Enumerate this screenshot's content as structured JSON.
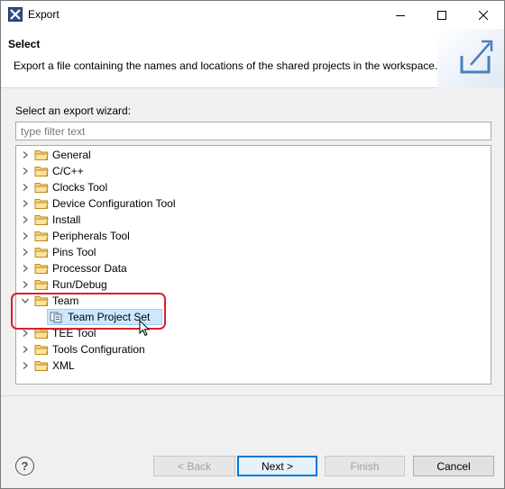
{
  "window": {
    "title": "Export"
  },
  "header": {
    "title": "Select",
    "description": "Export a file containing the names and locations of the shared projects in the workspace."
  },
  "wizard": {
    "section_label": "Select an export wizard:",
    "filter_placeholder": "type filter text",
    "filter_value": ""
  },
  "tree": {
    "items": [
      {
        "label": "General",
        "expanded": false
      },
      {
        "label": "C/C++",
        "expanded": false
      },
      {
        "label": "Clocks Tool",
        "expanded": false
      },
      {
        "label": "Device Configuration Tool",
        "expanded": false
      },
      {
        "label": "Install",
        "expanded": false
      },
      {
        "label": "Peripherals Tool",
        "expanded": false
      },
      {
        "label": "Pins Tool",
        "expanded": false
      },
      {
        "label": "Processor Data",
        "expanded": false
      },
      {
        "label": "Run/Debug",
        "expanded": false
      },
      {
        "label": "Team",
        "expanded": true,
        "children": [
          {
            "label": "Team Project Set",
            "selected": true
          }
        ]
      },
      {
        "label": "TEE Tool",
        "expanded": false
      },
      {
        "label": "Tools Configuration",
        "expanded": false
      },
      {
        "label": "XML",
        "expanded": false
      }
    ]
  },
  "footer": {
    "help_label": "?",
    "back_label": "< Back",
    "next_label": "Next >",
    "finish_label": "Finish",
    "cancel_label": "Cancel"
  },
  "colors": {
    "selection": "#cce8ff",
    "annotation": "#d9202c",
    "primary_border": "#0078d7",
    "folder": "#e8b84a"
  }
}
